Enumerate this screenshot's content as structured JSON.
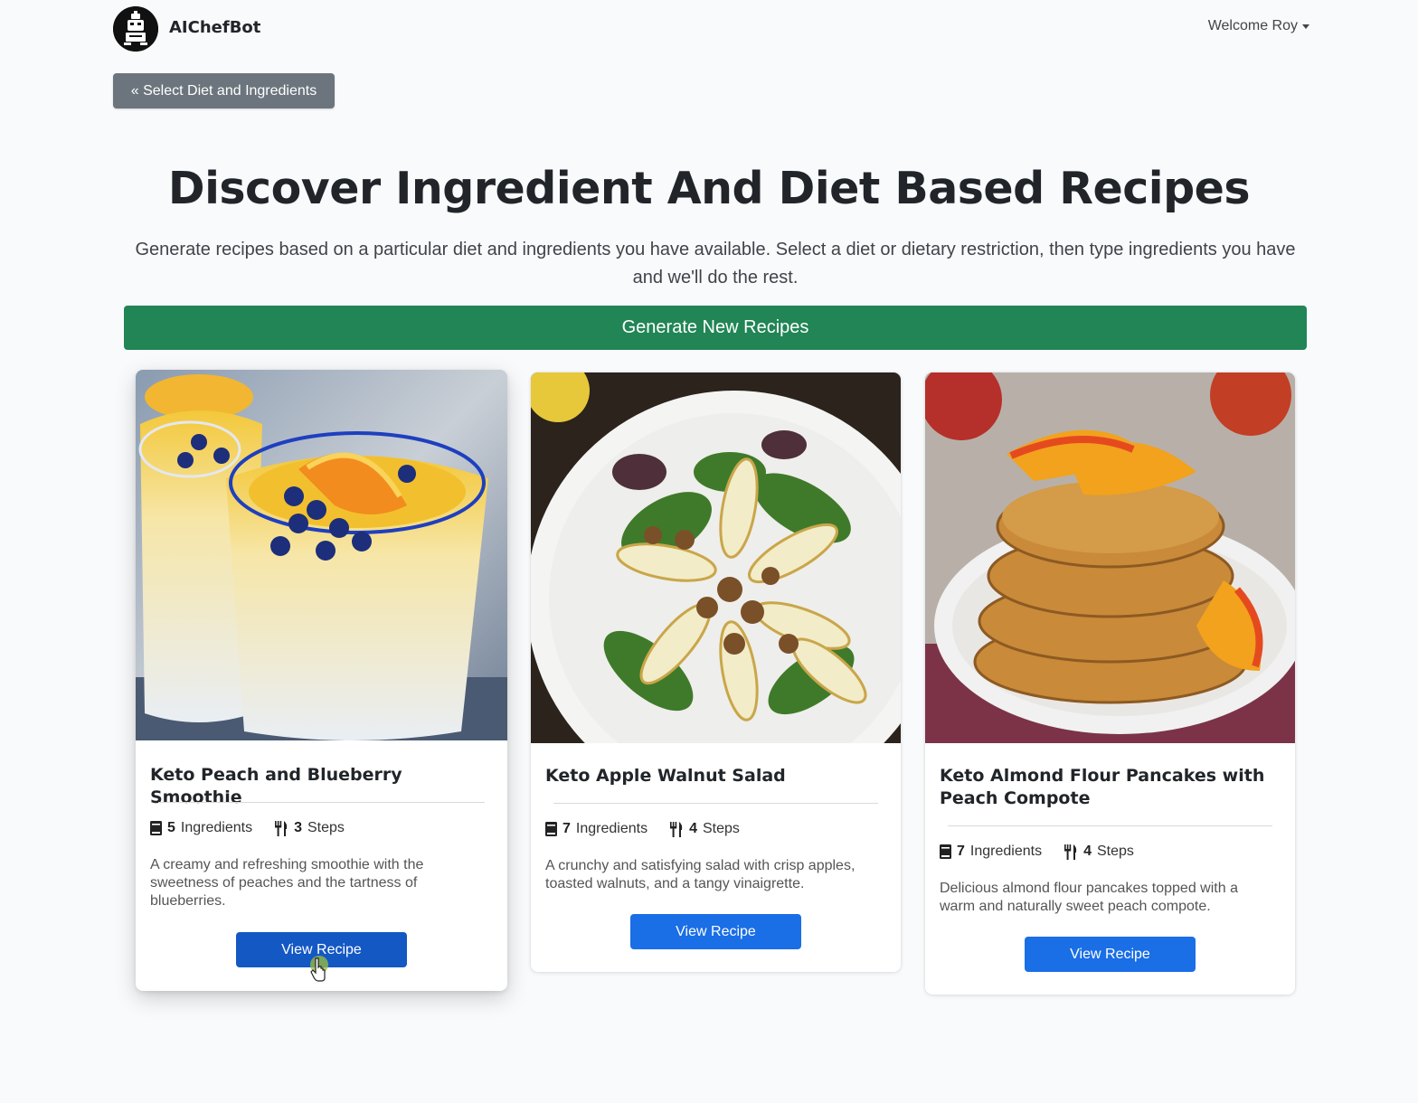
{
  "nav": {
    "brand": "AIChefBot",
    "welcome": "Welcome Roy",
    "logo_icon": "chef-robot-icon"
  },
  "back_button": {
    "label": "« Select Diet and Ingredients"
  },
  "hero": {
    "title": "Discover Ingredient And Diet Based Recipes",
    "subtitle": "Generate recipes based on a particular diet and ingredients you have available. Select a diet or dietary restriction, then type ingredients you have and we'll do the rest."
  },
  "generate_button": {
    "label": "Generate New Recipes",
    "color": "#218556"
  },
  "recipes": [
    {
      "title": "Keto Peach and Blueberry Smoothie",
      "ingredients_count": "5",
      "ingredients_label": "Ingredients",
      "steps_count": "3",
      "steps_label": "Steps",
      "description": "A creamy and refreshing smoothie with the sweetness of peaches and the tartness of blueberries.",
      "button": "View Recipe"
    },
    {
      "title": "Keto Apple Walnut Salad",
      "ingredients_count": "7",
      "ingredients_label": "Ingredients",
      "steps_count": "4",
      "steps_label": "Steps",
      "description": "A crunchy and satisfying salad with crisp apples, toasted walnuts, and a tangy vinaigrette.",
      "button": "View Recipe"
    },
    {
      "title": "Keto Almond Flour Pancakes with Peach Compote",
      "ingredients_count": "7",
      "ingredients_label": "Ingredients",
      "steps_count": "4",
      "steps_label": "Steps",
      "description": "Delicious almond flour pancakes topped with a warm and naturally sweet peach compote.",
      "button": "View Recipe"
    }
  ],
  "colors": {
    "primary": "#1a6ee6",
    "secondary": "#6c757d",
    "success": "#218556"
  }
}
